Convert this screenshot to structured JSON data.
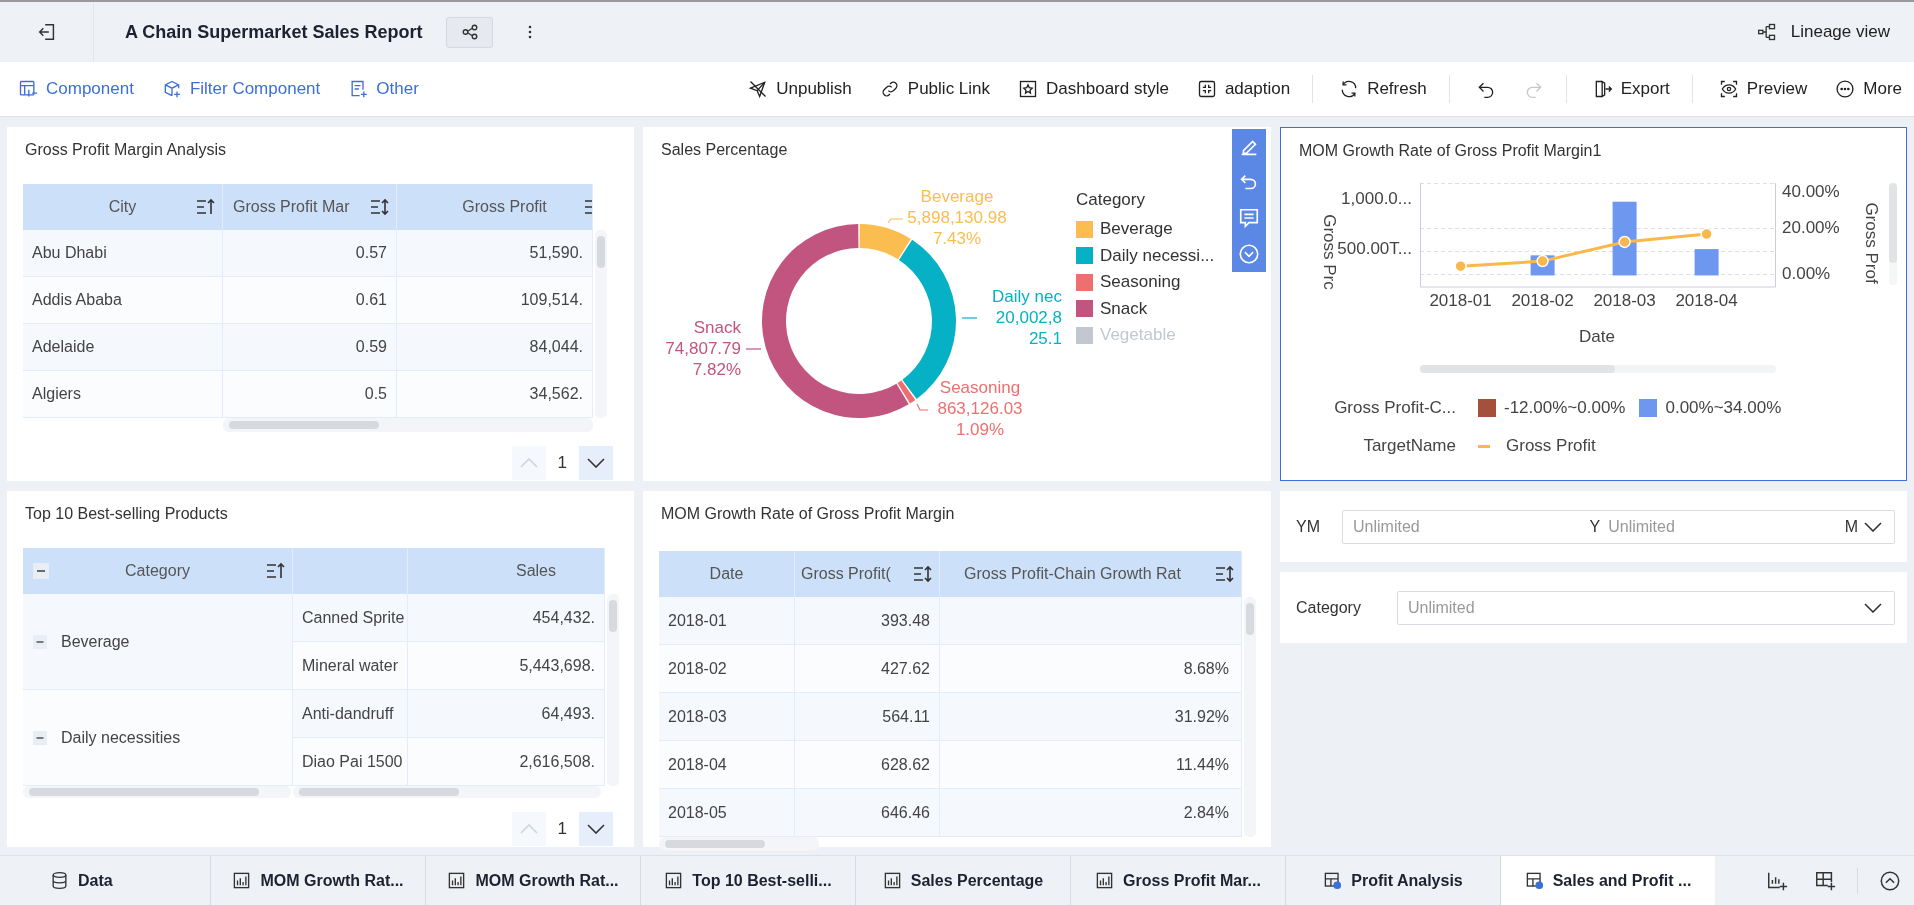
{
  "header": {
    "title": "A Chain Supermarket Sales Report",
    "lineage_label": "Lineage view"
  },
  "toolbar": {
    "left": [
      {
        "label": "Component"
      },
      {
        "label": "Filter Component"
      },
      {
        "label": "Other"
      }
    ],
    "right": [
      [
        {
          "label": "Unpublish",
          "disabled": false
        },
        {
          "label": "Public Link",
          "disabled": false
        },
        {
          "label": "Dashboard style",
          "disabled": false
        },
        {
          "label": "adaption",
          "disabled": false
        }
      ],
      [
        {
          "label": "Refresh",
          "disabled": false
        }
      ],
      [
        {
          "disabled": false
        },
        {
          "disabled": true
        }
      ],
      [
        {
          "label": "Export",
          "disabled": false
        }
      ],
      [
        {
          "label": "Preview",
          "disabled": false
        },
        {
          "label": "More",
          "disabled": false
        }
      ]
    ]
  },
  "profit_table": {
    "title": "Gross Profit Margin Analysis",
    "columns": [
      "City",
      "Gross Profit Mar",
      "Gross Profit"
    ],
    "rows": [
      [
        "Abu Dhabi",
        "0.57",
        "51,590."
      ],
      [
        "Addis Ababa",
        "0.61",
        "109,514."
      ],
      [
        "Adelaide",
        "0.59",
        "84,044."
      ],
      [
        "Algiers",
        "0.5",
        "34,562."
      ]
    ],
    "pager": {
      "page": "1",
      "prev_disabled": true,
      "next_disabled": false
    }
  },
  "sales_percentage": {
    "title": "Sales Percentage",
    "chart_data": {
      "type": "donut",
      "legend": "right",
      "categories": [
        "Beverage",
        "Daily necessi...",
        "Seasoning",
        "Snack",
        "Vegetable"
      ],
      "series": [
        {
          "values": [
            9.1,
            30.9,
            1.3,
            58.7,
            null
          ]
        }
      ]
    },
    "slice_labels": [
      {
        "name": "Beverage",
        "value": "5,898,130.98",
        "percent": "7.43%"
      },
      {
        "name": "Daily nec",
        "value": "20,002,8",
        "percent": "25.1"
      },
      {
        "name": "Seasoning",
        "value": "863,126.03",
        "percent": "1.09%"
      },
      {
        "name": "Snack",
        "value": "74,807.79",
        "percent": "7.82%"
      }
    ],
    "legend_title": "Category",
    "legend": [
      {
        "color": "#fbbd4f",
        "hidden": false
      },
      {
        "color": "#06b1c5",
        "hidden": false
      },
      {
        "color": "#ee6f6f",
        "hidden": false
      },
      {
        "color": "#c2557f",
        "hidden": false
      },
      {
        "color": "#c2c7d0",
        "hidden": true
      }
    ]
  },
  "mom_chart": {
    "title": "MOM Growth Rate of Gross Profit Margin1",
    "selected": true,
    "chart_data": {
      "type": "bar",
      "x": [
        "2018-01",
        "2018-02",
        "2018-03",
        "2018-04"
      ],
      "xlabel": "Date",
      "ylabel": "Gross Prof",
      "series": [
        {
          "type": "bar",
          "color": "#6e97f0",
          "values": [
            null,
            8.7,
            31.9,
            11.4
          ]
        },
        {
          "type": "line",
          "name": "Gross Profit",
          "color": "#fbb84a",
          "marker": true,
          "values": [
            4,
            6.2,
            14.5,
            17.9
          ]
        }
      ],
      "yticks": [
        {
          "value": 40,
          "label": "40.00%"
        },
        {
          "value": 20,
          "label": "20.00%"
        },
        {
          "value": 0,
          "label": "0.00%"
        }
      ],
      "ylim": [
        -5,
        40
      ]
    },
    "left_title": "Gross Prc",
    "left_ticks": [
      "1,000.0...",
      "500.00T..."
    ],
    "color_legend_title": "Gross Profit-C...",
    "ranges": [
      {
        "label": "-12.00%~0.00%",
        "color": "#a5503c"
      },
      {
        "label": "0.00%~34.00%",
        "color": "#6e97f0"
      }
    ],
    "target_title": "TargetName"
  },
  "top_products": {
    "title": "Top 10 Best-selling Products",
    "category_expanded": true,
    "columns": [
      "Category",
      "Sales"
    ],
    "groups": [
      {
        "name": "Beverage",
        "expanded": true,
        "items": [
          {
            "product": "Canned Sprite",
            "sales": "454,432."
          },
          {
            "product": "Mineral water",
            "sales": "5,443,698."
          }
        ]
      },
      {
        "name": "Daily necessities",
        "expanded": true,
        "items": [
          {
            "product": "Anti-dandruff",
            "sales": "64,493."
          },
          {
            "product": "Diao Pai 1500",
            "sales": "2,616,508."
          }
        ]
      }
    ],
    "pager": {
      "page": "1",
      "prev_disabled": true,
      "next_disabled": false
    }
  },
  "mom_table": {
    "title": "MOM Growth Rate of Gross Profit Margin",
    "columns": [
      "Date",
      "Gross Profit(",
      "Gross Profit-Chain Growth Rat"
    ],
    "rows": [
      [
        "2018-01",
        "393.48",
        ""
      ],
      [
        "2018-02",
        "427.62",
        "8.68%"
      ],
      [
        "2018-03",
        "564.11",
        "31.92%"
      ],
      [
        "2018-04",
        "628.62",
        "11.44%"
      ],
      [
        "2018-05",
        "646.46",
        "2.84%"
      ]
    ]
  },
  "filters": [
    {
      "kind": "year_month",
      "label": "YM",
      "placeholder": "Unlimited",
      "year_unit": "Y",
      "month_placeholder": "Unlimited",
      "month_unit": "M"
    },
    {
      "kind": "select",
      "label": "Category",
      "placeholder": "Unlimited"
    }
  ],
  "bottom_tabs": [
    {
      "kind": "data",
      "label": "Data",
      "selected": false
    },
    {
      "kind": "chart",
      "label": "MOM Growth Rat...",
      "selected": false
    },
    {
      "kind": "chart",
      "label": "MOM Growth Rat...",
      "selected": false
    },
    {
      "kind": "chart",
      "label": "Top 10 Best-selli...",
      "selected": false
    },
    {
      "kind": "chart",
      "label": "Sales Percentage",
      "selected": false
    },
    {
      "kind": "chart",
      "label": "Gross Profit Mar...",
      "selected": false
    },
    {
      "kind": "dashboard",
      "label": "Profit Analysis",
      "selected": false
    },
    {
      "kind": "dashboard",
      "label": "Sales and Profit ...",
      "selected": true
    }
  ]
}
